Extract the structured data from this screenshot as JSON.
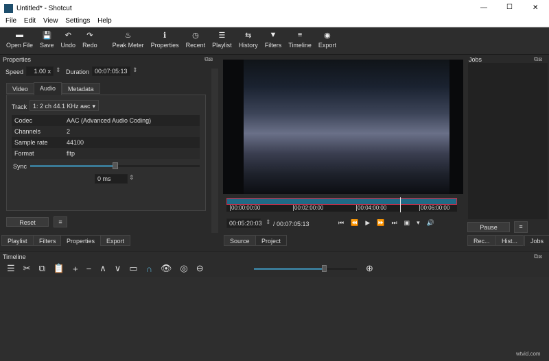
{
  "window": {
    "title": "Untitled* - Shotcut",
    "min": "—",
    "max": "☐",
    "close": "✕"
  },
  "menu": [
    "File",
    "Edit",
    "View",
    "Settings",
    "Help"
  ],
  "toolbar": [
    {
      "label": "Open File",
      "icon": "▬"
    },
    {
      "label": "Save",
      "icon": "💾"
    },
    {
      "label": "Undo",
      "icon": "↶"
    },
    {
      "label": "Redo",
      "icon": "↷"
    },
    {
      "label": "Peak Meter",
      "icon": "♨"
    },
    {
      "label": "Properties",
      "icon": "ℹ"
    },
    {
      "label": "Recent",
      "icon": "◷"
    },
    {
      "label": "Playlist",
      "icon": "☰"
    },
    {
      "label": "History",
      "icon": "⇆"
    },
    {
      "label": "Filters",
      "icon": "▼"
    },
    {
      "label": "Timeline",
      "icon": "≡"
    },
    {
      "label": "Export",
      "icon": "◉"
    }
  ],
  "properties": {
    "title": "Properties",
    "speed_label": "Speed",
    "speed": "1.00 x",
    "duration_label": "Duration",
    "duration": "00:07:05:13",
    "tabs": [
      "Video",
      "Audio",
      "Metadata"
    ],
    "track_label": "Track",
    "track": "1: 2 ch 44.1 KHz aac",
    "info": [
      [
        "Codec",
        "AAC (Advanced Audio Coding)"
      ],
      [
        "Channels",
        "2"
      ],
      [
        "Sample rate",
        "44100"
      ],
      [
        "Format",
        "fltp"
      ]
    ],
    "sync_label": "Sync",
    "sync_value": "0 ms",
    "sync_fraction": 0.5,
    "reset": "Reset",
    "menu_icon": "≡"
  },
  "left_tabs": [
    "Playlist",
    "Filters",
    "Properties",
    "Export"
  ],
  "player": {
    "ruler": [
      "00:00:00:00",
      "00:02:00:00",
      "00:04:00:00",
      "00:06:00:00"
    ],
    "playhead_fraction": 0.752,
    "position": "00:05:20:03",
    "total": "/ 00:07:05:13",
    "controls": [
      "⏮",
      "⏪",
      "▶",
      "⏩",
      "⏭",
      "▣",
      "▾",
      "🔊"
    ],
    "tabs": [
      "Source",
      "Project"
    ]
  },
  "jobs": {
    "title": "Jobs",
    "pause": "Pause",
    "menu_icon": "≡",
    "tabs": [
      "Rec...",
      "Hist...",
      "Jobs"
    ]
  },
  "timeline": {
    "title": "Timeline",
    "tools": [
      "☰",
      "✂",
      "⧉",
      "📋",
      "+",
      "−",
      "∧",
      "∨",
      "▭",
      "∩",
      "👁",
      "◎",
      "⊖"
    ],
    "zoom_in": "⊕",
    "zoom_fraction": 0.68
  },
  "watermark": "wtvid.com"
}
